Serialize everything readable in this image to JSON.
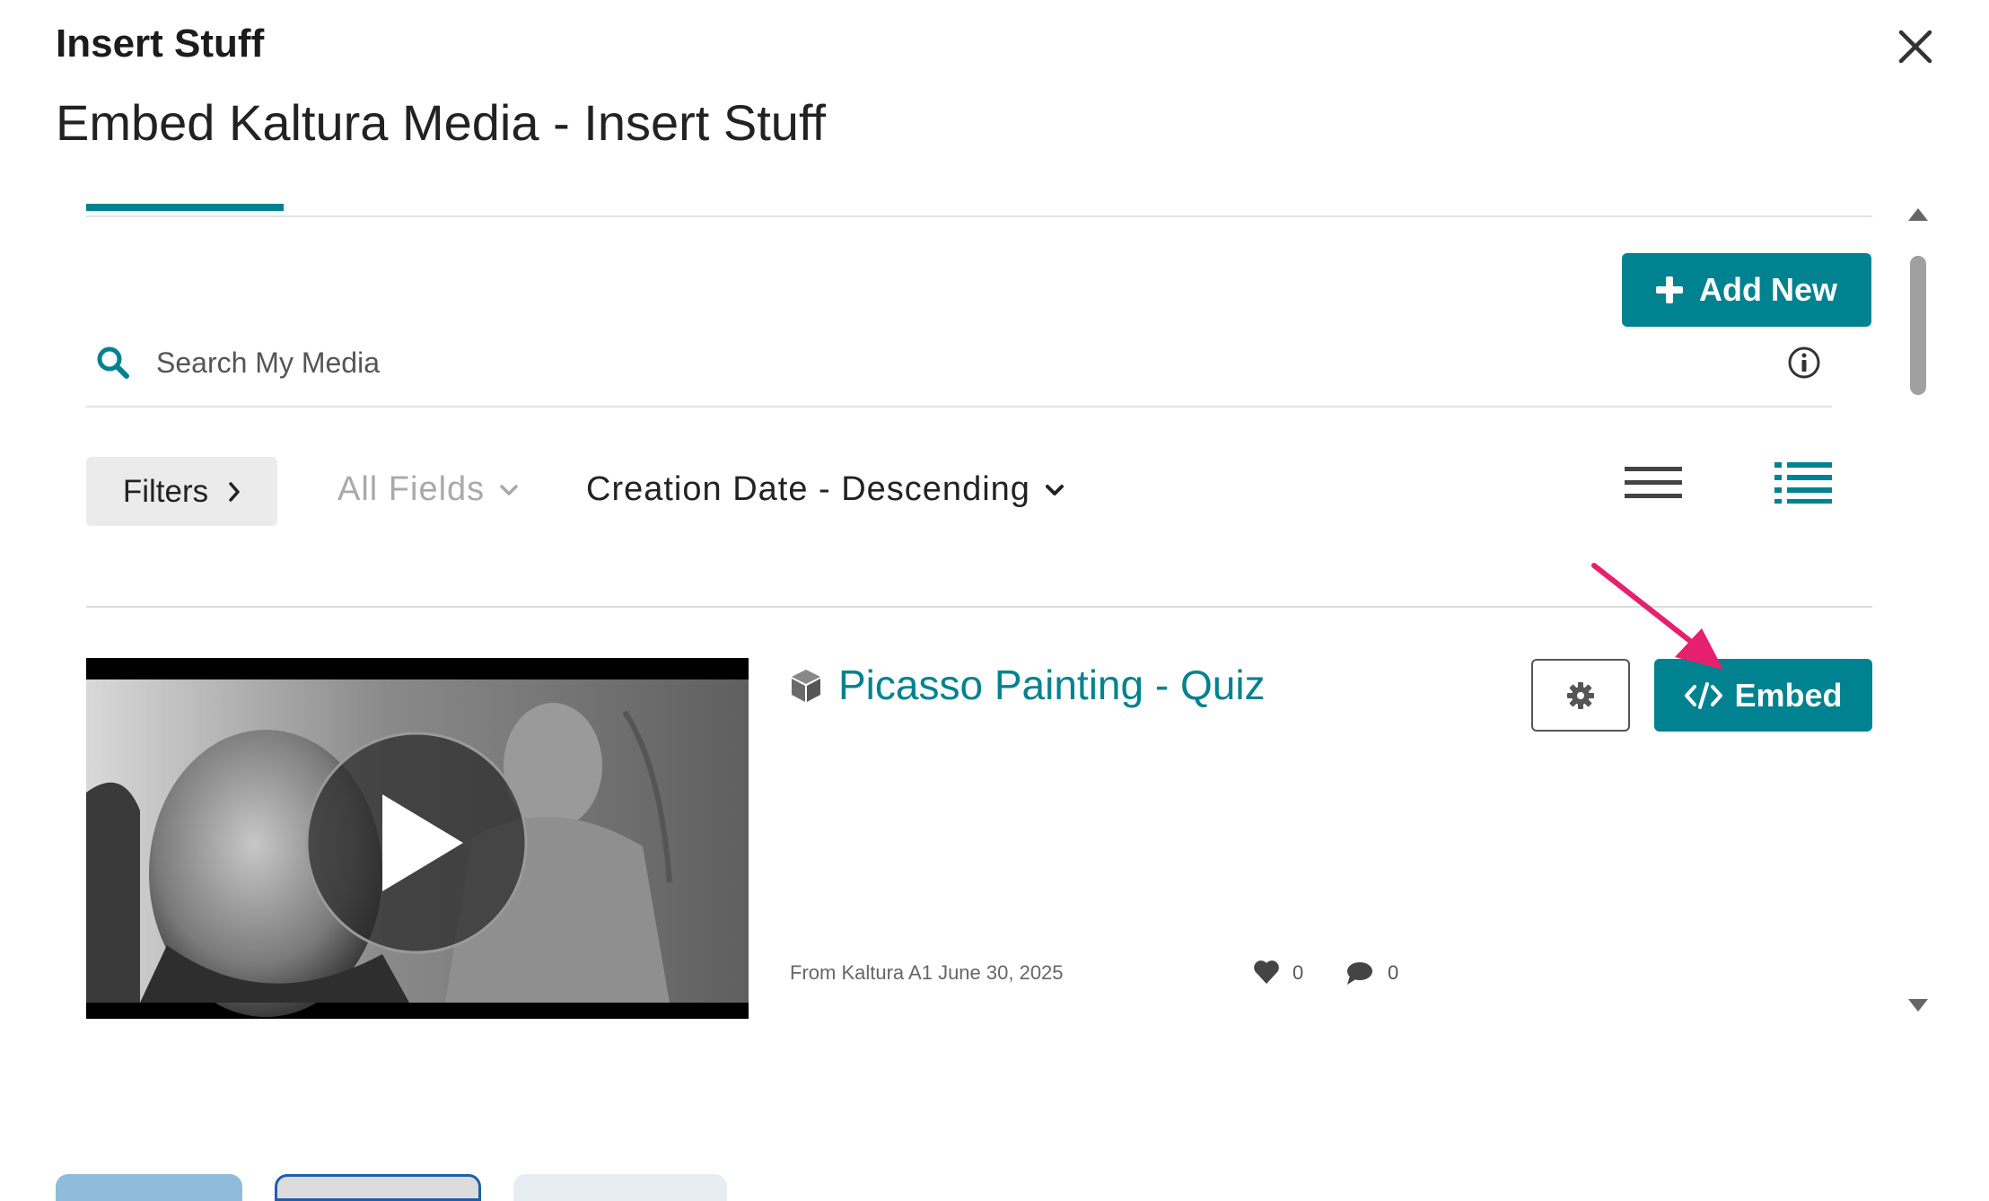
{
  "dialog": {
    "title": "Insert Stuff",
    "frame_title": "Embed Kaltura Media - Insert Stuff"
  },
  "toolbar": {
    "add_new_label": "Add New"
  },
  "search": {
    "placeholder": "Search My Media"
  },
  "filters": {
    "filters_label": "Filters",
    "fields_label": "All Fields",
    "sort_label": "Creation Date - Descending"
  },
  "entry": {
    "title": "Picasso Painting - Quiz",
    "meta": "From Kaltura A1 June 30, 2025",
    "likes": "0",
    "comments": "0",
    "embed_label": "Embed"
  },
  "colors": {
    "accent": "#008290",
    "annotation_arrow": "#e5206f"
  },
  "icons": {
    "close": "close-icon",
    "search": "search-icon",
    "info": "info-icon",
    "plus": "plus-icon",
    "gear": "gear-icon",
    "heart": "heart-icon",
    "comment": "comment-icon",
    "quiz": "cube-icon",
    "play": "play-icon"
  }
}
